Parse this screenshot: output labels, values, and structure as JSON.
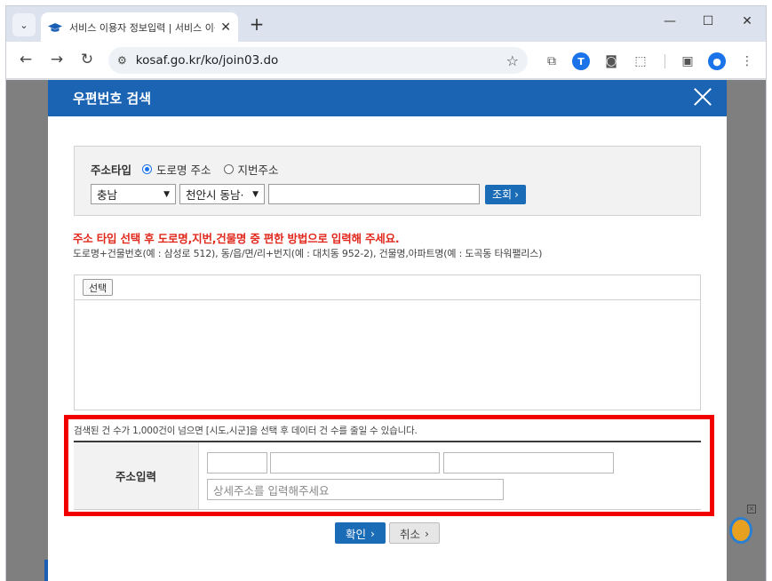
{
  "browser": {
    "tab_title": "서비스 이용자 정보입력 | 서비스 이용",
    "url": "kosaf.go.kr/ko/join03.do",
    "icons": [
      "tab-search-icon",
      "graduation-cap-icon",
      "close-icon",
      "plus-icon",
      "minimize-icon",
      "maximize-icon",
      "back-icon",
      "forward-icon",
      "reload-icon",
      "site-info-icon",
      "star-icon",
      "copy-icon",
      "translate-icon",
      "camera-icon",
      "extensions-icon",
      "sidepanel-icon",
      "profile-icon",
      "more-icon"
    ],
    "tab_close": "✕",
    "new_tab": "+",
    "window_controls": {
      "minimize": "—",
      "maximize": "☐",
      "close": "✕"
    },
    "nav": {
      "back": "←",
      "forward": "→",
      "reload": "↻"
    },
    "toolbar_glyphs": {
      "star": "☆",
      "copy": "⧉",
      "translate": "T",
      "camera": "◙",
      "extensions": "⬚",
      "sidepanel": "▣",
      "profile": "●",
      "more": "⋮"
    }
  },
  "modal": {
    "title": "우편번호 검색",
    "search": {
      "type_label": "주소타입",
      "option_road": "도로명 주소",
      "option_lot": "지번주소",
      "selected_option": "도로명 주소",
      "province_value": "충남",
      "city_value": "천안시 동남·",
      "keyword_value": "",
      "search_button": "조회"
    },
    "notice_red": "주소 타입 선택 후 도로명,지번,건물명 중 편한 방법으로 입력해 주세요.",
    "notice_example": "도로명+건물번호(예 : 삼성로 512), 동/읍/면/리+번지(예 : 대치동 952-2), 건물명,아파트명(예 : 도곡동 타워팰리스)",
    "select_button": "선택",
    "count_notice": "검색된 건 수가 1,000건이 넘으면 [시도,시군]을 선택 후 데이터 건 수를 줄일 수 있습니다.",
    "address_label": "주소입력",
    "detail_placeholder": "상세주소를 입력해주세요",
    "confirm_button": "확인",
    "cancel_button": "취소"
  },
  "colors": {
    "header_blue": "#1b63b3",
    "button_blue": "#1a6cb7",
    "notice_red": "#e0281c",
    "highlight_red": "#f20000"
  }
}
